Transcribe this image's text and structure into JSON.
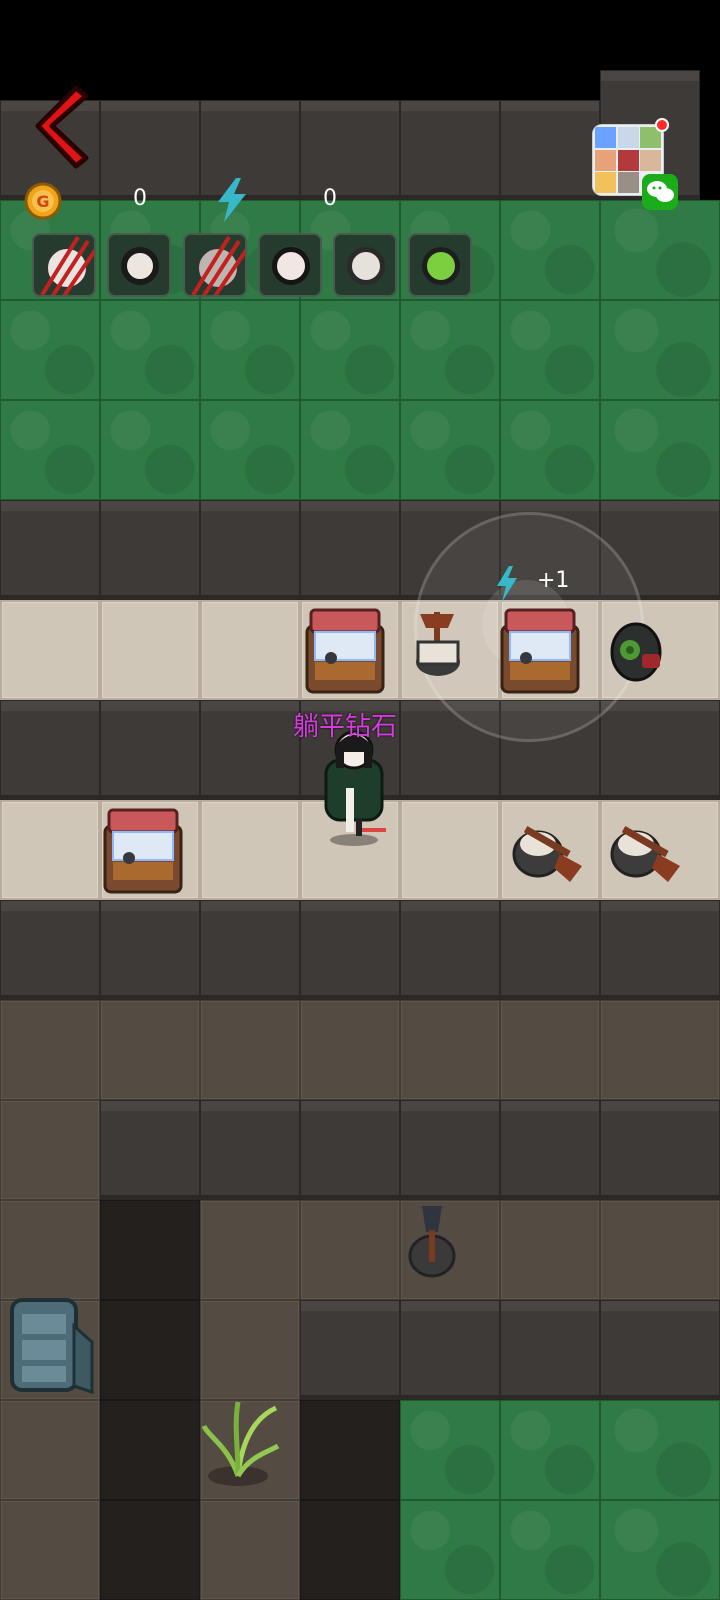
{
  "hud": {
    "coins": "0",
    "energy": "0",
    "player_name": "躺平钻石",
    "energy_gain": "+1"
  },
  "icons": {
    "back": "back-arrow-icon",
    "coin": "coin-g-icon",
    "energy": "lightning-bolt-icon",
    "miniapp": "wechat-miniapp-icon"
  },
  "avatars": [
    {
      "name": "white-hair-ghost",
      "status": "scratched"
    },
    {
      "name": "black-hair-boy",
      "status": "normal"
    },
    {
      "name": "gray-ghost",
      "status": "scratched"
    },
    {
      "name": "bow-girl",
      "status": "normal"
    },
    {
      "name": "glasses-girl",
      "status": "normal"
    },
    {
      "name": "green-zombie",
      "status": "normal"
    }
  ],
  "colors": {
    "grass": "#2f7a45",
    "wall": "#3e3a37",
    "floor": "#cfc6b8",
    "name": "#d63be0",
    "back": "#e01414"
  }
}
